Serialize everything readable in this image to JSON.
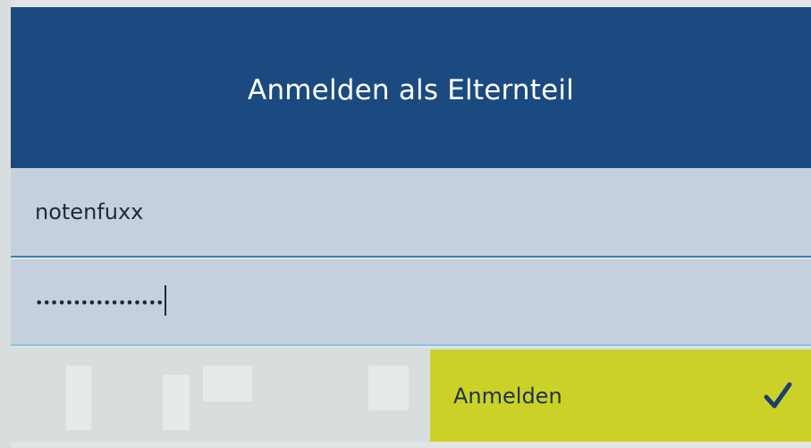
{
  "header": {
    "title": "Anmelden als Elternteil"
  },
  "form": {
    "username": {
      "value": "notenfuxx"
    },
    "password": {
      "masked_value": "•••••••••••••••••"
    },
    "submit": {
      "label": "Anmelden",
      "icon": "checkmark-icon"
    }
  },
  "colors": {
    "header_bg": "#1b4a80",
    "field_bg": "#c6d0dc",
    "button_bg": "#ccd128",
    "check": "#1b3f6e"
  }
}
